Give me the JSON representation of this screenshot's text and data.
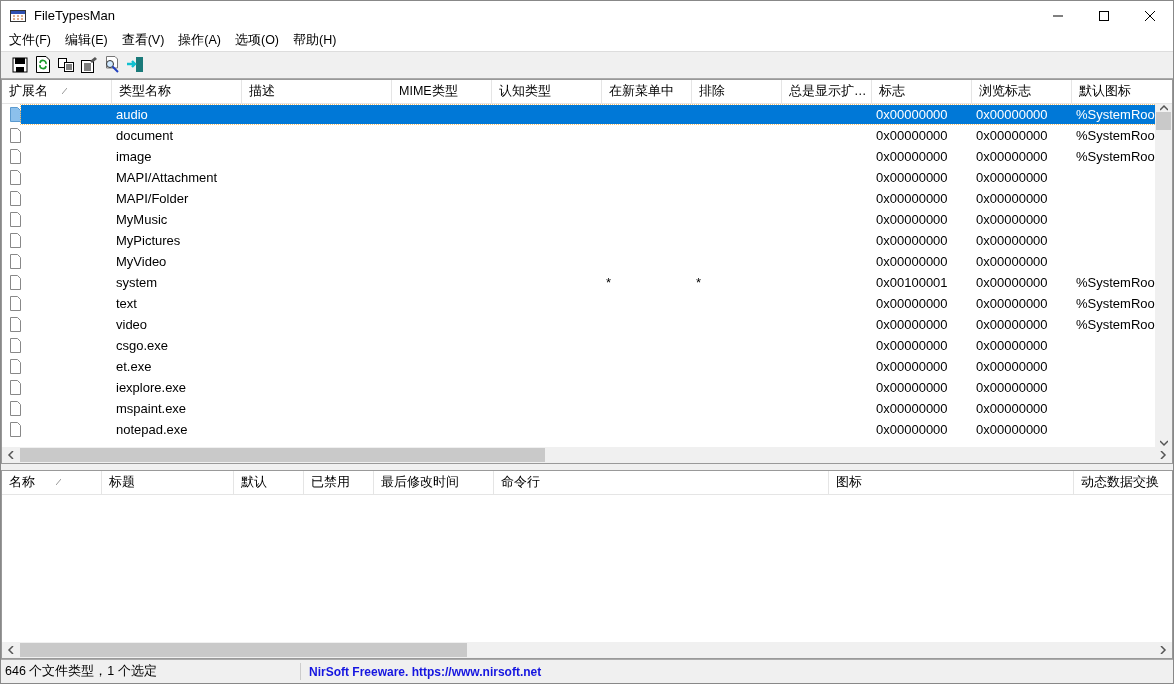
{
  "window": {
    "title": "FileTypesMan"
  },
  "menu": [
    {
      "label": "文件(F)"
    },
    {
      "label": "编辑(E)"
    },
    {
      "label": "查看(V)"
    },
    {
      "label": "操作(A)"
    },
    {
      "label": "选项(O)"
    },
    {
      "label": "帮助(H)"
    }
  ],
  "toolbar": [
    {
      "kind": "save"
    },
    {
      "kind": "refresh"
    },
    {
      "kind": "copy"
    },
    {
      "kind": "properties"
    },
    {
      "kind": "find"
    },
    {
      "kind": "exit"
    }
  ],
  "file_types": {
    "columns": [
      {
        "label": "扩展名",
        "sorted": true
      },
      {
        "label": "类型名称",
        "sorted": false
      },
      {
        "label": "描述",
        "sorted": false
      },
      {
        "label": "MIME类型",
        "sorted": false
      },
      {
        "label": "认知类型",
        "sorted": false
      },
      {
        "label": "在新菜单中",
        "sorted": false
      },
      {
        "label": "排除",
        "sorted": false
      },
      {
        "label": "总是显示扩…",
        "sorted": false
      },
      {
        "label": "标志",
        "sorted": false
      },
      {
        "label": "浏览标志",
        "sorted": false
      },
      {
        "label": "默认图标",
        "sorted": false
      }
    ],
    "rows": [
      {
        "type_name": "audio",
        "flags": "0x00000000",
        "browse_flags": "0x00000000",
        "default_icon": "%SystemRoo",
        "selected": true
      },
      {
        "type_name": "document",
        "flags": "0x00000000",
        "browse_flags": "0x00000000",
        "default_icon": "%SystemRoo",
        "selected": false
      },
      {
        "type_name": "image",
        "flags": "0x00000000",
        "browse_flags": "0x00000000",
        "default_icon": "%SystemRoo",
        "selected": false
      },
      {
        "type_name": "MAPI/Attachment",
        "flags": "0x00000000",
        "browse_flags": "0x00000000",
        "selected": false
      },
      {
        "type_name": "MAPI/Folder",
        "flags": "0x00000000",
        "browse_flags": "0x00000000",
        "selected": false
      },
      {
        "type_name": "MyMusic",
        "flags": "0x00000000",
        "browse_flags": "0x00000000",
        "selected": false
      },
      {
        "type_name": "MyPictures",
        "flags": "0x00000000",
        "browse_flags": "0x00000000",
        "selected": false
      },
      {
        "type_name": "MyVideo",
        "flags": "0x00000000",
        "browse_flags": "0x00000000",
        "selected": false
      },
      {
        "type_name": "system",
        "in_new_menu": "*",
        "exclude": "*",
        "flags": "0x00100001",
        "browse_flags": "0x00000000",
        "default_icon": "%SystemRoo",
        "selected": false
      },
      {
        "type_name": "text",
        "flags": "0x00000000",
        "browse_flags": "0x00000000",
        "default_icon": "%SystemRoo",
        "selected": false
      },
      {
        "type_name": "video",
        "flags": "0x00000000",
        "browse_flags": "0x00000000",
        "default_icon": "%SystemRoo",
        "selected": false
      },
      {
        "type_name": "csgo.exe",
        "flags": "0x00000000",
        "browse_flags": "0x00000000",
        "selected": false
      },
      {
        "type_name": "et.exe",
        "flags": "0x00000000",
        "browse_flags": "0x00000000",
        "selected": false
      },
      {
        "type_name": "iexplore.exe",
        "flags": "0x00000000",
        "browse_flags": "0x00000000",
        "selected": false
      },
      {
        "type_name": "mspaint.exe",
        "flags": "0x00000000",
        "browse_flags": "0x00000000",
        "selected": false
      },
      {
        "type_name": "notepad.exe",
        "flags": "0x00000000",
        "browse_flags": "0x00000000",
        "selected": false
      }
    ]
  },
  "actions": {
    "columns": [
      {
        "label": "名称",
        "sorted": true
      },
      {
        "label": "标题",
        "sorted": false
      },
      {
        "label": "默认",
        "sorted": false
      },
      {
        "label": "已禁用",
        "sorted": false
      },
      {
        "label": "最后修改时间",
        "sorted": false
      },
      {
        "label": "命令行",
        "sorted": false
      },
      {
        "label": "图标",
        "sorted": false
      },
      {
        "label": "动态数据交换",
        "sorted": false
      }
    ]
  },
  "status_bar": {
    "count": "646 个文件类型，1 个选定",
    "link": "NirSoft Freeware. https://www.nirsoft.net"
  }
}
